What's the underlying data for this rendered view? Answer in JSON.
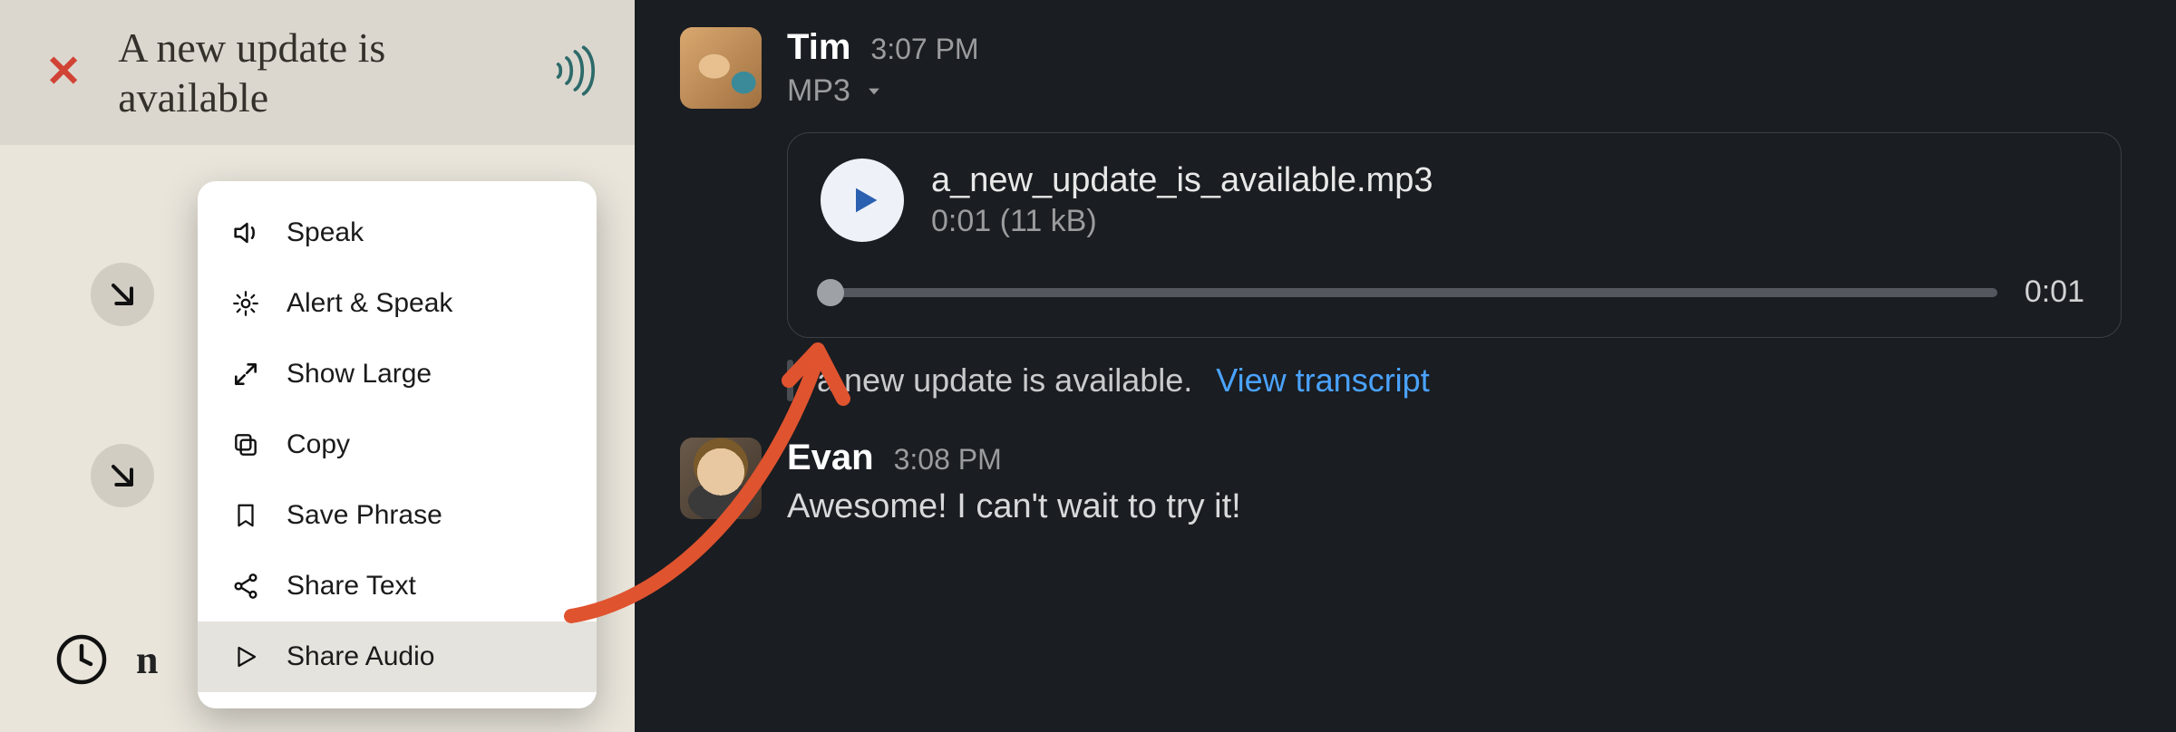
{
  "left": {
    "banner_title": "A new update is available",
    "partial_text": "n"
  },
  "menu": {
    "items": [
      "Speak",
      "Alert & Speak",
      "Show Large",
      "Copy",
      "Save Phrase",
      "Share Text",
      "Share Audio"
    ]
  },
  "chat": {
    "msg1": {
      "name": "Tim",
      "time": "3:07 PM",
      "filetype": "MP3",
      "audio": {
        "filename": "a_new_update_is_available.mp3",
        "meta": "0:01 (11 kB)",
        "elapsed": "0:01"
      },
      "transcript_text": "a new update is available.",
      "transcript_link": "View transcript"
    },
    "msg2": {
      "name": "Evan",
      "time": "3:08 PM",
      "text": "Awesome! I can't wait to try it!"
    }
  }
}
